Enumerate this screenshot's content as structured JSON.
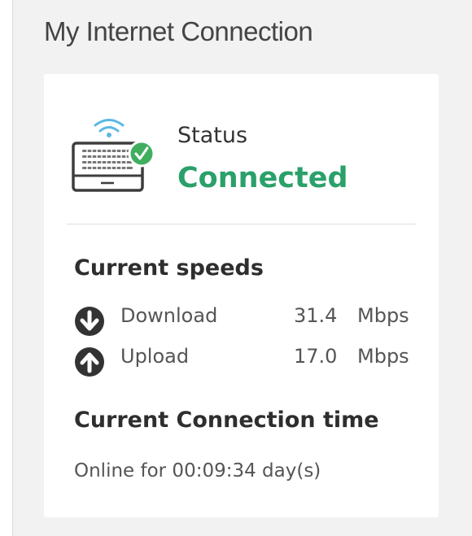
{
  "panel": {
    "title": "My Internet Connection"
  },
  "status": {
    "label": "Status",
    "value": "Connected",
    "icon": "router-connected-icon",
    "value_color": "#2aa06a",
    "check_color": "#3fae5f",
    "wifi_color": "#5bb8e6"
  },
  "speeds": {
    "title": "Current speeds",
    "rows": [
      {
        "icon": "download-arrow-icon",
        "label": "Download",
        "value": "31.4",
        "unit": "Mbps"
      },
      {
        "icon": "upload-arrow-icon",
        "label": "Upload",
        "value": "17.0",
        "unit": "Mbps"
      }
    ]
  },
  "connection_time": {
    "title": "Current Connection time",
    "text": "Online for 00:09:34 day(s)"
  }
}
